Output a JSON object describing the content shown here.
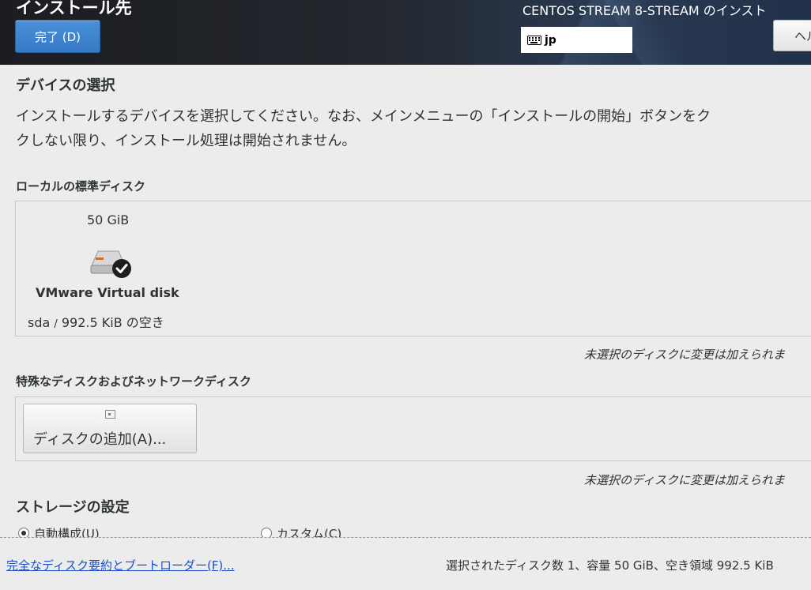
{
  "header": {
    "spoke_title": "インストール先",
    "done_button": "完了 (D)",
    "distro_title": "CENTOS STREAM 8-STREAM のインスト",
    "keyboard_layout": "jp",
    "help_button": "ヘル"
  },
  "device_selection": {
    "heading": "デバイスの選択",
    "description_line1": "インストールするデバイスを選択してください。なお、メインメニューの「インストールの開始」ボタンをク",
    "description_line2": "クしない限り、インストール処理は開始されません。"
  },
  "local_disks": {
    "heading": "ローカルの標準ディスク",
    "disks": [
      {
        "size": "50 GiB",
        "name": "VMware Virtual disk",
        "device": "sda",
        "separator": "/",
        "free": "992.5 KiB の空き",
        "selected": true
      }
    ],
    "note": "未選択のディスクに変更は加えられま"
  },
  "special_disks": {
    "heading": "特殊なディスクおよびネットワークディスク",
    "add_button": "ディスクの追加(A)...",
    "note": "未選択のディスクに変更は加えられま"
  },
  "storage_config": {
    "heading": "ストレージの設定",
    "options": [
      {
        "label": "自動構成(U)",
        "checked": true
      },
      {
        "label": "カスタム(C)",
        "checked": false
      }
    ]
  },
  "footer": {
    "summary_link": "完全なディスク要約とブートローダー(F)...",
    "selection_summary": "選択されたディスク数 1、容量 50 GiB、空き領域 992.5 KiB"
  }
}
